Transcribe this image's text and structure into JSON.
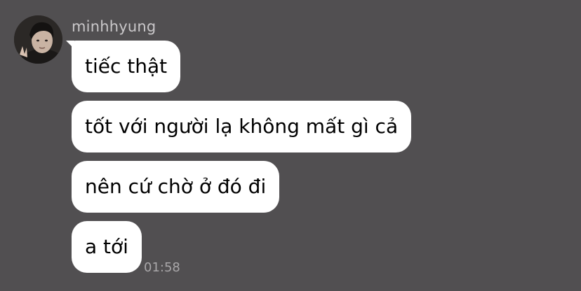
{
  "conversation": {
    "sender_name": "minhhyung",
    "messages": [
      {
        "text": "tiếc thật"
      },
      {
        "text": "tốt với người lạ không mất gì cả"
      },
      {
        "text": "nên cứ chờ ở đó đi"
      },
      {
        "text": "a tới"
      }
    ],
    "last_timestamp": "01:58"
  },
  "colors": {
    "background": "#514f51",
    "bubble": "#ffffff",
    "text": "#000000",
    "meta_text": "#c9c7c9"
  },
  "icons": {
    "avatar": "profile-photo"
  }
}
